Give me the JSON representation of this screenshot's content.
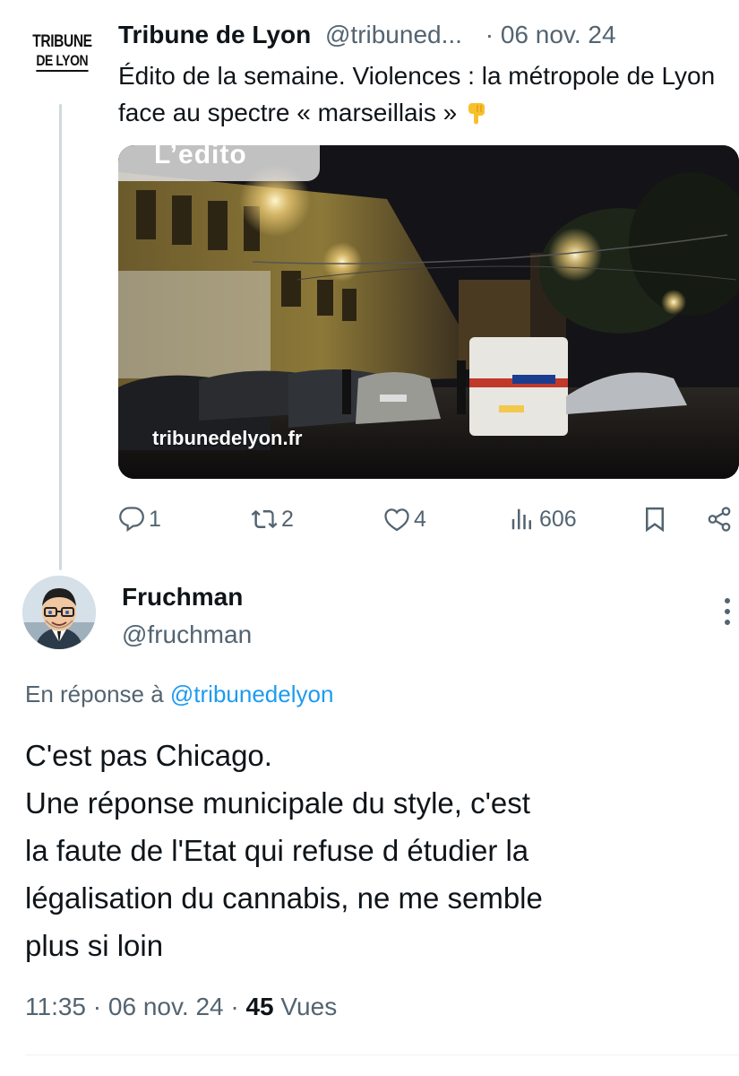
{
  "parent_tweet": {
    "logo_lines": [
      "TRIBUNE",
      "DE LYON"
    ],
    "author_name": "Tribune de Lyon",
    "author_handle": "@tribuned...",
    "date": "· 06 nov. 24",
    "text": "Édito de la semaine. Violences : la métropole de Lyon face au spectre « marseillais »",
    "emoji_icon": "backhand-index-pointing-down-icon",
    "media": {
      "overlay_label": "L’edito",
      "watermark": "tribunedelyon.fr"
    },
    "actions": {
      "reply_count": "1",
      "retweet_count": "2",
      "like_count": "4",
      "views_count": "606",
      "bookmark_icon": "bookmark-icon",
      "share_icon": "share-icon"
    }
  },
  "reply_tweet": {
    "author_name": "Fruchman",
    "author_handle": "@fruchman",
    "reply_to_prefix": "En réponse à",
    "reply_to_handle": "@tribunedelyon",
    "text_lines": [
      "C'est pas Chicago.",
      "Une réponse municipale du style, c'est",
      "la faute de l'Etat qui refuse d étudier la",
      "légalisation du cannabis, ne me semble",
      "plus si loin"
    ],
    "time": "11:35",
    "date": "06 nov. 24",
    "views_number": "45",
    "views_label": "Vues"
  },
  "colors": {
    "text_primary": "#0f1419",
    "text_secondary": "#536471",
    "link": "#1d9bf0",
    "thread_line": "#cfd9de"
  }
}
